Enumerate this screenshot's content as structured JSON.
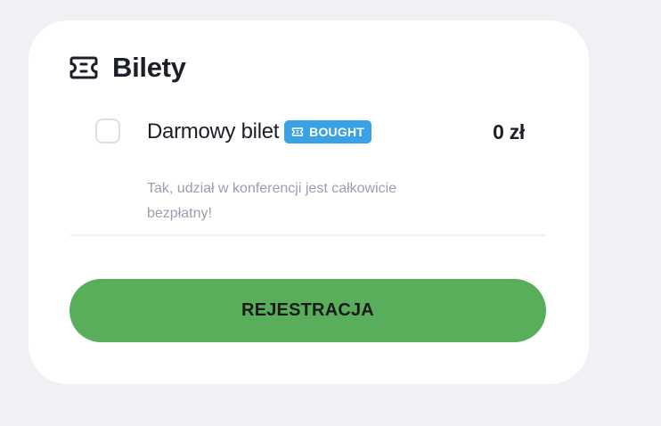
{
  "section": {
    "title": "Bilety",
    "icon": "ticket-icon"
  },
  "ticket": {
    "name": "Darmowy bilet",
    "badge": {
      "label": "BOUGHT",
      "icon": "ticket-icon",
      "color": "#3aa2e4"
    },
    "price": "0 zł",
    "description": "Tak, udział w konferencji jest całkowicie bezpłatny!",
    "checked": false
  },
  "actions": {
    "register_label": "REJESTRACJA",
    "register_color": "#58ae5b"
  }
}
